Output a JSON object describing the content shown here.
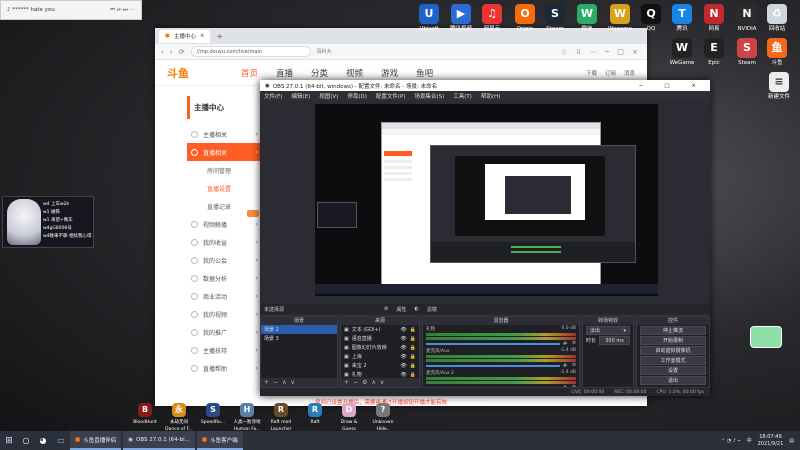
{
  "music": {
    "title": "♪ ****** hate you"
  },
  "desktop_icons": [
    {
      "label": "Ubisoft",
      "color": "#1e63c8",
      "glyph": "U"
    },
    {
      "label": "腾讯视频",
      "color": "#2b6bd6",
      "glyph": "▶"
    },
    {
      "label": "网易云",
      "color": "#e33",
      "glyph": "♫"
    },
    {
      "label": "Origin",
      "color": "#f56c0d",
      "glyph": "O"
    },
    {
      "label": "Steam",
      "color": "#1b2838",
      "glyph": "S"
    },
    {
      "label": "微信",
      "color": "#2aae67",
      "glyph": "W"
    },
    {
      "label": "Wegame",
      "color": "#d8a11a",
      "glyph": "W"
    },
    {
      "label": "QQ",
      "color": "#111",
      "glyph": "Q"
    },
    {
      "label": "腾讯",
      "color": "#1685e6",
      "glyph": "T"
    },
    {
      "label": "网易",
      "color": "#c3282c",
      "glyph": "N"
    },
    {
      "label": "NVIDIA",
      "color": "#2c2c2c",
      "glyph": "N"
    },
    {
      "label": "回收站",
      "color": "#cfd6de",
      "glyph": "♻"
    }
  ],
  "desktop_icons_row2": [
    {
      "label": "WeGame",
      "color": "#222",
      "glyph": "W"
    },
    {
      "label": "Epic",
      "color": "#222",
      "glyph": "E"
    },
    {
      "label": "Steam",
      "color": "#c44",
      "glyph": "S"
    },
    {
      "label": "斗鱼",
      "color": "#f06a1a",
      "glyph": "鱼"
    }
  ],
  "desktop_file": {
    "label": "新建文件",
    "color": "#e8e8e8",
    "glyph": "📄"
  },
  "browser": {
    "tab_title": "主播中心",
    "new_tab": "+",
    "url": "//mp.douyu.com/live/main",
    "search_hint": "百科大",
    "logo": "斗鱼",
    "nav": [
      "首页",
      "直播",
      "分类",
      "视频",
      "游戏",
      "鱼吧"
    ],
    "nav_right": [
      "下载",
      "订阅",
      "消息"
    ],
    "sidebar_title": "主播中心",
    "sidebar": [
      {
        "label": "主播相关",
        "kind": "item"
      },
      {
        "label": "直播相关",
        "kind": "active"
      },
      {
        "label": "房间管理",
        "kind": "sub"
      },
      {
        "label": "直播设置",
        "kind": "subact"
      },
      {
        "label": "直播记录",
        "kind": "sub"
      },
      {
        "label": "视频鲸播",
        "kind": "item"
      },
      {
        "label": "我的收益",
        "kind": "item"
      },
      {
        "label": "我的公会",
        "kind": "item"
      },
      {
        "label": "数据分析",
        "kind": "item"
      },
      {
        "label": "商业活动",
        "kind": "item"
      },
      {
        "label": "我的视频",
        "kind": "item"
      },
      {
        "label": "我的推广",
        "kind": "item"
      },
      {
        "label": "主播扶持",
        "kind": "item"
      },
      {
        "label": "直播帮助",
        "kind": "item"
      }
    ],
    "notice": "房间已设置开播后，需要再通过开播按钮开播才能有效"
  },
  "obs": {
    "title": "OBS 27.0.1 (64-bit, windows) - 配置文件: 未命名 - 场景: 未命名",
    "menu": [
      "文件(F)",
      "编辑(E)",
      "视图(V)",
      "停靠(D)",
      "配置文件(P)",
      "场景集合(S)",
      "工具(T)",
      "帮助(H)"
    ],
    "ctrl": [
      "未选择源",
      "属性",
      "滤镜"
    ],
    "panels": {
      "scenes": "场景",
      "sources": "来源",
      "mixer": "混音器",
      "transitions": "转场特效",
      "controls": "控件"
    },
    "scenes": [
      "场景 2",
      "场景 3"
    ],
    "sources": [
      "文本 (GDI+)",
      "语音直播",
      "图像幻灯片放映",
      "上海",
      "来宝 2",
      "礼物"
    ],
    "mixer": [
      {
        "name": "礼物",
        "db": "0.0 dB"
      },
      {
        "name": "麦克风/Aux",
        "db": "-1.4 dB"
      },
      {
        "name": "麦克风/Aux 2",
        "db": "-1.4 dB"
      }
    ],
    "transition": {
      "type": "淡出",
      "duration_label": "时长",
      "duration": "300 ms"
    },
    "controls": [
      "停止推流",
      "开始录制",
      "启动虚拟摄像机",
      "工作室模式",
      "设置",
      "退出"
    ],
    "status": [
      "LIVE: 00:00:00",
      "REC: 00:00:00",
      "CPU: 1.0%, 60.00 fps"
    ]
  },
  "avatar": {
    "lines": [
      "w4 上车w2h",
      "w1 磁铁",
      "w1 来望+晚车",
      "w4gG8006号",
      "w4晚車不聊 相续我心得"
    ]
  },
  "bottom_icons": [
    {
      "label": "BloodHunt",
      "color": "#8a1a1a",
      "glyph": "B"
    },
    {
      "label": "永劫无间 Dance of F...",
      "color": "#d98a1a",
      "glyph": "永"
    },
    {
      "label": "SpeedRu...",
      "color": "#2a4a8a",
      "glyph": "S"
    },
    {
      "label": "人类一败涂地 Human Fa...",
      "color": "#5a7fa8",
      "glyph": "H"
    },
    {
      "label": "Raft mod Launcher",
      "color": "#6a4a2a",
      "glyph": "R"
    },
    {
      "label": "Raft",
      "color": "#2a7fb8",
      "glyph": "R"
    },
    {
      "label": "Draw & Guess",
      "color": "#d8a8c8",
      "glyph": "D"
    },
    {
      "label": "Unknown Hide..",
      "color": "#777",
      "glyph": "?"
    }
  ],
  "taskbar": {
    "apps": [
      "斗鱼直播伴侣",
      "OBS 27.0.1 (64-bi...",
      "斗鱼客户端"
    ],
    "time": "18:07:49",
    "date": "2021/9/21",
    "lang": "中"
  }
}
